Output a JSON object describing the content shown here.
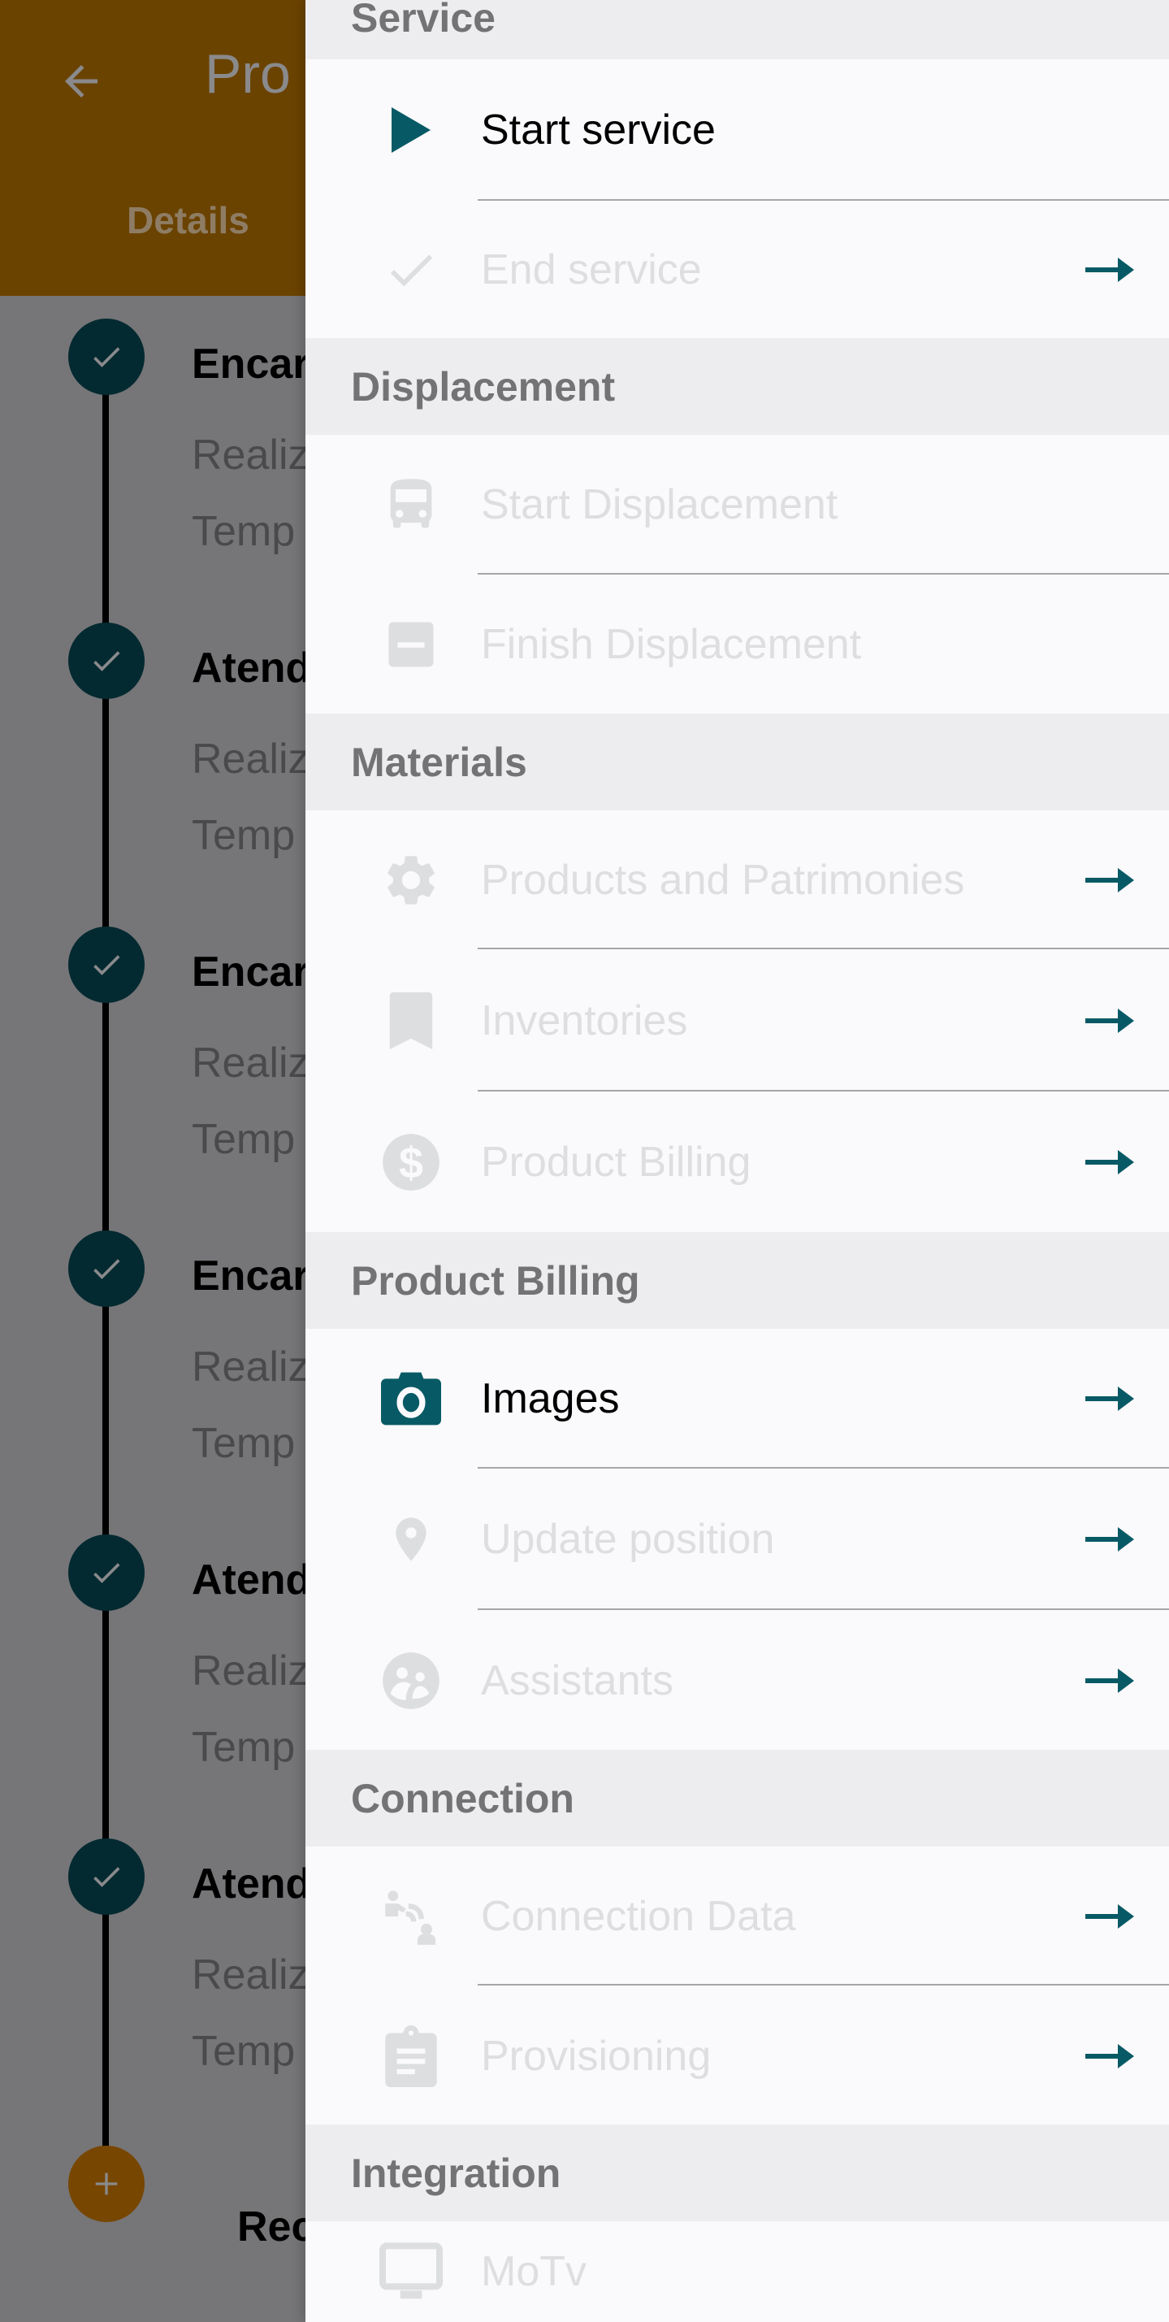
{
  "background": {
    "appbar": {
      "title": "Pro",
      "back_icon": "arrow-back-icon",
      "tab_label": "Details",
      "color": "#6b4301"
    },
    "timeline": [
      {
        "title": "Encar",
        "line1": "Realiz",
        "line2": "Temp",
        "status": "done"
      },
      {
        "title": "Atend",
        "line1": "Realiz",
        "line2": "Temp",
        "status": "done"
      },
      {
        "title": "Encar",
        "line1": "Realiz",
        "line2": "Temp",
        "status": "done"
      },
      {
        "title": "Encar",
        "line1": "Realiz",
        "line2": "Temp",
        "status": "done"
      },
      {
        "title": "Atend",
        "line1": "Realiz",
        "line2": "Temp",
        "status": "done"
      },
      {
        "title": "Atend",
        "line1": "Realiz",
        "line2": "Temp",
        "status": "done"
      }
    ],
    "add_step": {
      "icon": "plus",
      "label": "Rec"
    }
  },
  "drawer": {
    "accent_color": "#075a65",
    "sections": [
      {
        "title": "Service",
        "items": [
          {
            "label": "Start service",
            "icon": "play-icon",
            "enabled": true,
            "arrow": false
          },
          {
            "label": "End service",
            "icon": "check-icon",
            "enabled": false,
            "arrow": true
          }
        ]
      },
      {
        "title": "Displacement",
        "items": [
          {
            "label": "Start Displacement",
            "icon": "bus-icon",
            "enabled": false,
            "arrow": false
          },
          {
            "label": "Finish Displacement",
            "icon": "minus-box-icon",
            "enabled": false,
            "arrow": false
          }
        ]
      },
      {
        "title": "Materials",
        "items": [
          {
            "label": "Products and Patrimonies",
            "icon": "gear-icon",
            "enabled": false,
            "arrow": true
          },
          {
            "label": "Inventories",
            "icon": "bookmark-icon",
            "enabled": false,
            "arrow": true
          },
          {
            "label": "Product Billing",
            "icon": "dollar-icon",
            "enabled": false,
            "arrow": true
          }
        ]
      },
      {
        "title": "Product Billing",
        "items": [
          {
            "label": "Images",
            "icon": "camera-icon",
            "enabled": true,
            "arrow": true
          },
          {
            "label": "Update position",
            "icon": "location-pin-icon",
            "enabled": false,
            "arrow": true
          },
          {
            "label": "Assistants",
            "icon": "people-icon",
            "enabled": false,
            "arrow": true
          }
        ]
      },
      {
        "title": "Connection",
        "items": [
          {
            "label": "Connection Data",
            "icon": "connection-icon",
            "enabled": false,
            "arrow": true
          },
          {
            "label": "Provisioning",
            "icon": "clipboard-icon",
            "enabled": false,
            "arrow": true
          }
        ]
      },
      {
        "title": "Integration",
        "items": [
          {
            "label": "MoTv",
            "icon": "monitor-icon",
            "enabled": false,
            "arrow": false
          }
        ]
      }
    ]
  }
}
